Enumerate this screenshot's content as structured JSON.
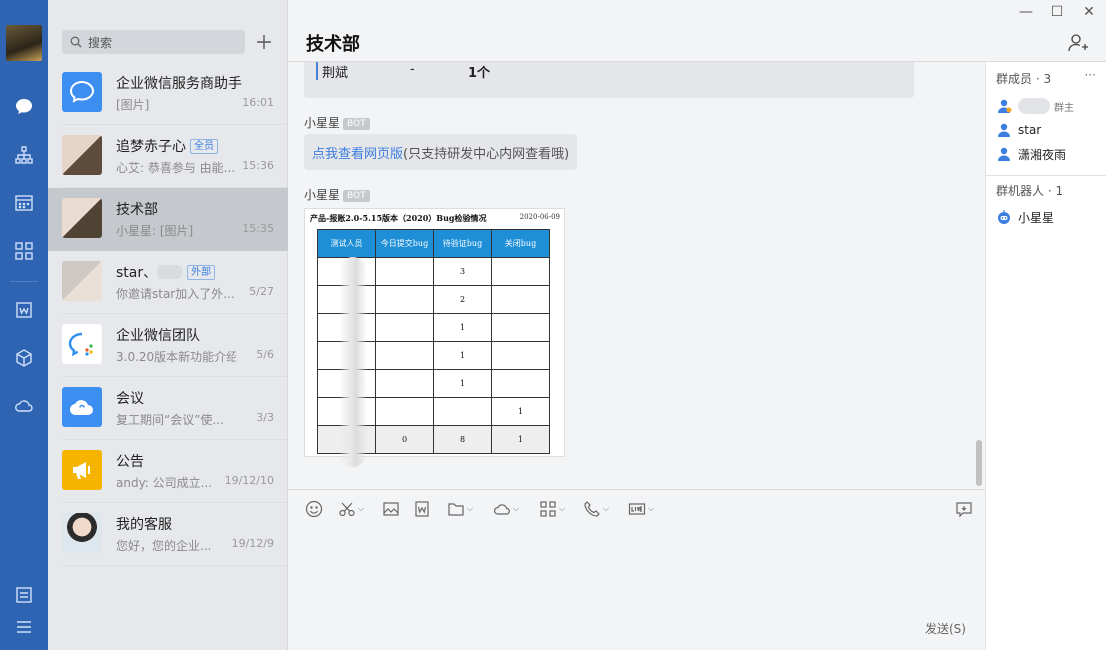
{
  "window": {
    "minimize_label": "—",
    "maximize_label": "☐",
    "close_label": "✕"
  },
  "search": {
    "placeholder": "搜索"
  },
  "conversations": [
    {
      "name": "企业微信服务商助手",
      "preview": "[图片]",
      "time": "16:01"
    },
    {
      "name": "追梦赤子心",
      "tag": "全员",
      "preview": "心艾: 恭喜参与 由能...",
      "time": "15:36"
    },
    {
      "name": "技术部",
      "preview": "小星星: [图片]",
      "time": "15:35"
    },
    {
      "name": "star、",
      "tag": "外部",
      "preview": "你邀请star加入了外...",
      "time": "5/27"
    },
    {
      "name": "企业微信团队",
      "preview": "3.0.20版本新功能介绍",
      "time": "5/6"
    },
    {
      "name": "会议",
      "preview": "复工期间“会议”使...",
      "time": "3/3"
    },
    {
      "name": "公告",
      "preview": "andy: 公司成立...",
      "time": "19/12/10"
    },
    {
      "name": "我的客服",
      "preview": "您好，您的企业...",
      "time": "19/12/9"
    }
  ],
  "chat": {
    "title": "技术部",
    "partial_row": {
      "name": "荆斌",
      "dash": "-",
      "count": "1个"
    },
    "messages": [
      {
        "sender": "小星星",
        "badge": "BOT",
        "link_text": "点我查看网页版",
        "rest_text": "(只支持研发中心内网查看哦)"
      },
      {
        "sender": "小星星",
        "badge": "BOT"
      }
    ],
    "image_report": {
      "title": "产品-报账2.0-5.15版本（2020）Bug检验情况",
      "date": "2020-06-09",
      "headers": [
        "测试人员",
        "今日提交bug",
        "待验证bug",
        "关闭bug"
      ],
      "rows": [
        [
          "",
          "",
          "3",
          ""
        ],
        [
          "",
          "",
          "2",
          ""
        ],
        [
          "",
          "",
          "1",
          ""
        ],
        [
          "",
          "",
          "1",
          ""
        ],
        [
          "",
          "",
          "1",
          ""
        ],
        [
          "",
          "",
          "",
          "1"
        ],
        [
          "",
          "0",
          "8",
          "1"
        ]
      ]
    },
    "send_label": "发送(S)"
  },
  "members": {
    "header": "群成员 · 3",
    "more": "···",
    "list": [
      {
        "name": "",
        "role": "群主"
      },
      {
        "name": "star"
      },
      {
        "name": "潇湘夜雨"
      }
    ],
    "bots_header": "群机器人 · 1",
    "bots": [
      {
        "name": "小星星"
      }
    ]
  },
  "colors": {
    "rail": "#2f64b3",
    "accent": "#3c7ee0",
    "table_header": "#1e8fd6"
  }
}
